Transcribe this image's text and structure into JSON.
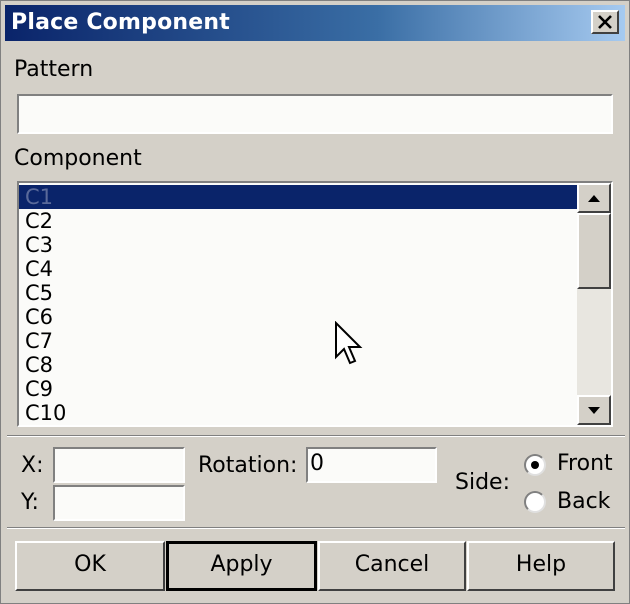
{
  "window": {
    "title": "Place Component"
  },
  "pattern": {
    "label": "Pattern",
    "value": ""
  },
  "component": {
    "label": "Component",
    "items": [
      "C1",
      "C2",
      "C3",
      "C4",
      "C5",
      "C6",
      "C7",
      "C8",
      "C9",
      "C10"
    ],
    "selected_index": 0
  },
  "position": {
    "x_label": "X:",
    "x_value": "",
    "y_label": "Y:",
    "y_value": "",
    "rotation_label": "Rotation:",
    "rotation_value": "0"
  },
  "side": {
    "label": "Side:",
    "options": [
      "Front",
      "Back"
    ],
    "selected": "Front"
  },
  "buttons": {
    "ok": "OK",
    "apply": "Apply",
    "cancel": "Cancel",
    "help": "Help"
  },
  "colors": {
    "title_bar": "#0a246a",
    "selection": "#0a246a",
    "face": "#d4d0c8"
  }
}
